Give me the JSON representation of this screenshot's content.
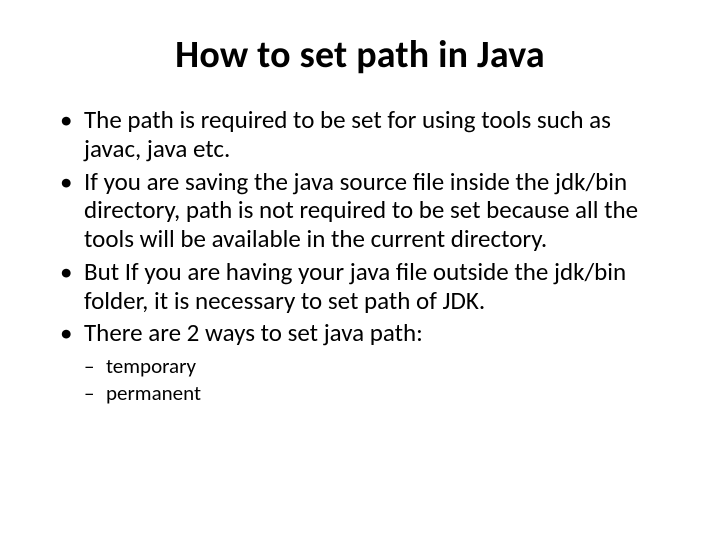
{
  "title": "How to set path in Java",
  "bullets": [
    "The path is required to be set for using tools such as javac, java etc.",
    "If you are saving the java source file inside the jdk/bin directory, path is not required to be set because all the tools will be available in the current directory.",
    "But If you are having your java file outside the jdk/bin folder, it is necessary to set path of JDK.",
    "There are 2 ways to set java path:"
  ],
  "subbullets": [
    "temporary",
    "permanent"
  ]
}
